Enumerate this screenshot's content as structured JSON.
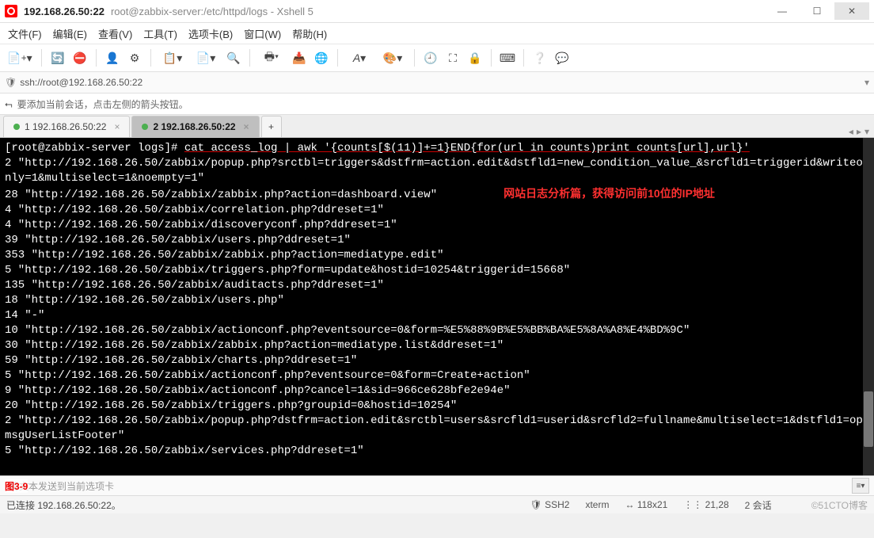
{
  "window": {
    "host": "192.168.26.50:22",
    "subtitle": "root@zabbix-server:/etc/httpd/logs - Xshell 5"
  },
  "menu": {
    "file": "文件(F)",
    "edit": "编辑(E)",
    "view": "查看(V)",
    "tools": "工具(T)",
    "tabs": "选项卡(B)",
    "window": "窗口(W)",
    "help": "帮助(H)"
  },
  "address": {
    "url": "ssh://root@192.168.26.50:22"
  },
  "hint": {
    "text": "要添加当前会话，点击左侧的箭头按钮。"
  },
  "tabs": {
    "t1": "1 192.168.26.50:22",
    "t2": "2 192.168.26.50:22"
  },
  "terminal": {
    "prompt": "[root@zabbix-server logs]# ",
    "command": "cat access_log | awk '{counts[$(11)]+=1}END{for(url in counts)print counts[url],url}'",
    "annotation": "网站日志分析篇，获得访问前10位的IP地址",
    "lines": [
      "2 \"http://192.168.26.50/zabbix/popup.php?srctbl=triggers&dstfrm=action.edit&dstfld1=new_condition_value_&srcfld1=triggerid&writeonly=1&multiselect=1&noempty=1\"",
      "28 \"http://192.168.26.50/zabbix/zabbix.php?action=dashboard.view\"",
      "4 \"http://192.168.26.50/zabbix/correlation.php?ddreset=1\"",
      "4 \"http://192.168.26.50/zabbix/discoveryconf.php?ddreset=1\"",
      "39 \"http://192.168.26.50/zabbix/users.php?ddreset=1\"",
      "353 \"http://192.168.26.50/zabbix/zabbix.php?action=mediatype.edit\"",
      "5 \"http://192.168.26.50/zabbix/triggers.php?form=update&hostid=10254&triggerid=15668\"",
      "135 \"http://192.168.26.50/zabbix/auditacts.php?ddreset=1\"",
      "18 \"http://192.168.26.50/zabbix/users.php\"",
      "14 \"-\"",
      "10 \"http://192.168.26.50/zabbix/actionconf.php?eventsource=0&form=%E5%88%9B%E5%BB%BA%E5%8A%A8%E4%BD%9C\"",
      "30 \"http://192.168.26.50/zabbix/zabbix.php?action=mediatype.list&ddreset=1\"",
      "59 \"http://192.168.26.50/zabbix/charts.php?ddreset=1\"",
      "5 \"http://192.168.26.50/zabbix/actionconf.php?eventsource=0&form=Create+action\"",
      "9 \"http://192.168.26.50/zabbix/actionconf.php?cancel=1&sid=966ce628bfe2e94e\"",
      "20 \"http://192.168.26.50/zabbix/triggers.php?groupid=0&hostid=10254\"",
      "2 \"http://192.168.26.50/zabbix/popup.php?dstfrm=action.edit&srctbl=users&srcfld1=userid&srcfld2=fullname&multiselect=1&dstfld1=opmsgUserListFooter\"",
      "5 \"http://192.168.26.50/zabbix/services.php?ddreset=1\""
    ]
  },
  "sendbar": {
    "figure": "图3-9",
    "placeholder": "将文本发送到当前选项卡"
  },
  "status": {
    "connected": "已连接 192.168.26.50:22。",
    "proto": "SSH2",
    "term": "xterm",
    "size": "118x21",
    "cursor": "21,28",
    "sessions": "2 会话",
    "watermark": "©51CTO博客"
  }
}
